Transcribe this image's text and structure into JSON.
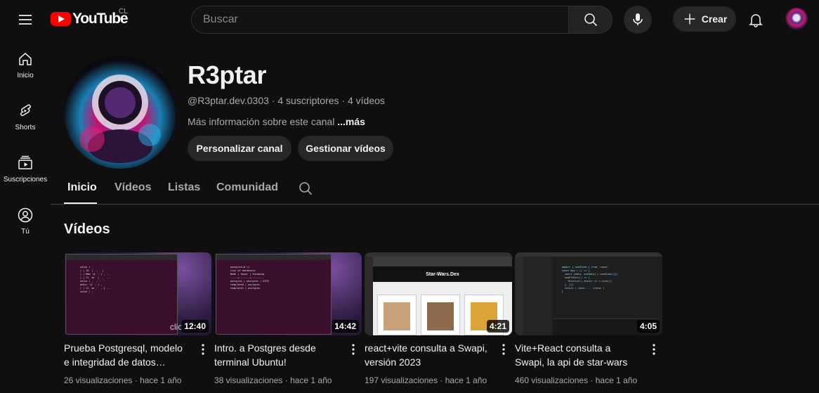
{
  "header": {
    "logo_text": "YouTube",
    "country_code": "CL",
    "search_placeholder": "Buscar",
    "create_label": "Crear"
  },
  "sidebar": {
    "items": [
      {
        "label": "Inicio",
        "icon": "home-icon"
      },
      {
        "label": "Shorts",
        "icon": "shorts-icon"
      },
      {
        "label": "Suscripciones",
        "icon": "subscriptions-icon"
      },
      {
        "label": "Tú",
        "icon": "you-icon"
      }
    ]
  },
  "channel": {
    "name": "R3ptar",
    "handle": "@R3ptar.dev.0303",
    "subscribers": "4 suscriptores",
    "videos_count": "4 vídeos",
    "about": "Más información sobre este canal",
    "more": "...más",
    "customize_label": "Personalizar canal",
    "manage_label": "Gestionar vídeos"
  },
  "tabs": [
    {
      "label": "Inicio",
      "active": true
    },
    {
      "label": "Vídeos",
      "active": false
    },
    {
      "label": "Listas",
      "active": false
    },
    {
      "label": "Comunidad",
      "active": false
    }
  ],
  "section_title": "Vídeos",
  "videos": [
    {
      "title": "Prueba Postgresql, modelo e integridad de datos desde…",
      "duration": "12:40",
      "views": "26 visualizaciones",
      "age": "hace 1 año"
    },
    {
      "title": "Intro. a Postgres desde terminal Ubuntu!",
      "duration": "14:42",
      "views": "38 visualizaciones",
      "age": "hace 1 año"
    },
    {
      "title": "react+vite consulta a Swapi, versión 2023",
      "duration": "4:21",
      "views": "197 visualizaciones",
      "age": "hace 1 año"
    },
    {
      "title": "Vite+React consulta a Swapi, la api de star-wars",
      "duration": "4:05",
      "views": "460 visualizaciones",
      "age": "hace 1 año"
    }
  ],
  "thumb_texts": {
    "starwars_title": "Star-Wars.Dex",
    "partial_word": "clic"
  },
  "colors": {
    "background": "#0f0f0f",
    "brand_red": "#ff0000",
    "pill_bg": "#272727",
    "muted_text": "#aaaaaa"
  }
}
